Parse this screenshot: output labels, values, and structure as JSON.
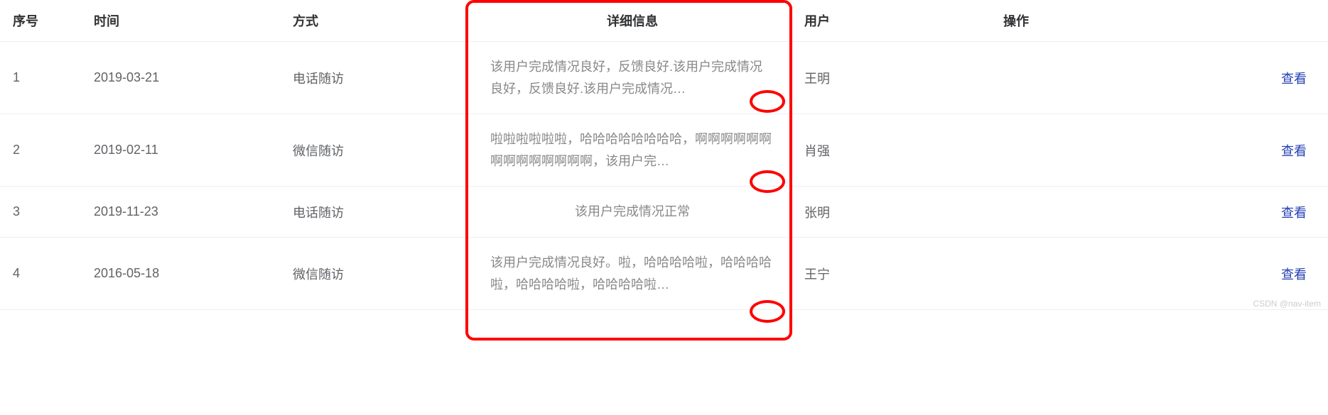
{
  "headers": {
    "index": "序号",
    "time": "时间",
    "method": "方式",
    "detail": "详细信息",
    "user": "用户",
    "action": "操作"
  },
  "rows": [
    {
      "index": "1",
      "time": "2019-03-21",
      "method": "电话随访",
      "detail": "该用户完成情况良好，反馈良好.该用户完成情况良好，反馈良好.该用户完成情况…",
      "user": "王明",
      "action": "查看",
      "single": false
    },
    {
      "index": "2",
      "time": "2019-02-11",
      "method": "微信随访",
      "detail": "啦啦啦啦啦啦，哈哈哈哈哈哈哈哈，啊啊啊啊啊啊啊啊啊啊啊啊啊啊，该用户完…",
      "user": "肖强",
      "action": "查看",
      "single": false
    },
    {
      "index": "3",
      "time": "2019-11-23",
      "method": "电话随访",
      "detail": "该用户完成情况正常",
      "user": "张明",
      "action": "查看",
      "single": true
    },
    {
      "index": "4",
      "time": "2016-05-18",
      "method": "微信随访",
      "detail": "该用户完成情况良好。啦，哈哈哈哈啦，哈哈哈哈啦，哈哈哈哈啦，哈哈哈哈啦…",
      "user": "王宁",
      "action": "查看",
      "single": false
    }
  ],
  "watermark": "CSDN @nav-item"
}
